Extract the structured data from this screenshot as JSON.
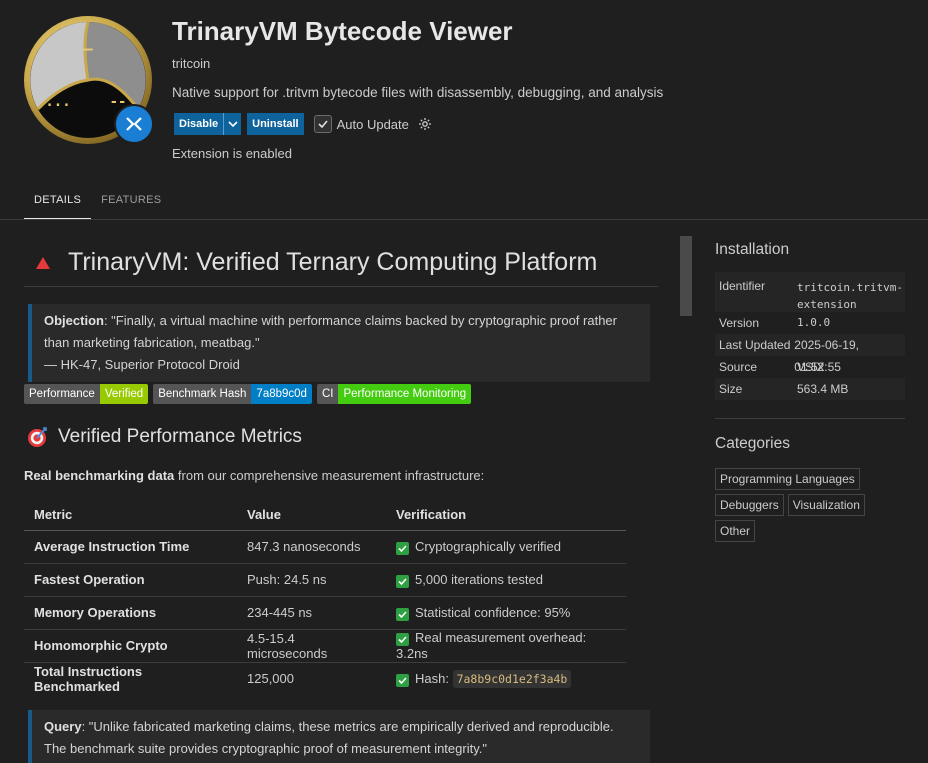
{
  "extension": {
    "title": "TrinaryVM Bytecode Viewer",
    "publisher": "tritcoin",
    "description": "Native support for .tritvm bytecode files with disassembly, debugging, and analysis",
    "logo_glyphs": {
      "top": "—",
      "bottom_left": "...",
      "bottom_right": "--"
    },
    "status": "Extension is enabled"
  },
  "actions": {
    "disable_label": "Disable",
    "uninstall_label": "Uninstall",
    "auto_update_label": "Auto Update",
    "auto_update_checked": true
  },
  "tabs": [
    {
      "label": "DETAILS",
      "active": true
    },
    {
      "label": "FEATURES",
      "active": false
    }
  ],
  "readme": {
    "h1_icon": "red-triangle-icon",
    "h1": "TrinaryVM: Verified Ternary Computing Platform",
    "objection": {
      "label": "Objection",
      "text": ": \"Finally, a virtual machine with performance claims backed by cryptographic proof rather than marketing fabrication, meatbag.\"",
      "attribution": "— HK-47, Superior Protocol Droid"
    },
    "badges": [
      {
        "key": "Performance",
        "value": "Verified",
        "color": "#97ca00"
      },
      {
        "key": "Benchmark Hash",
        "value": "7a8b9c0d",
        "color": "#007ec6"
      },
      {
        "key": "CI",
        "value": "Performance Monitoring",
        "color": "#4c1"
      }
    ],
    "h2_icon": "target-icon",
    "h2": "Verified Performance Metrics",
    "intro_bold": "Real benchmarking data",
    "intro_rest": " from our comprehensive measurement infrastructure:",
    "table": {
      "headers": [
        "Metric",
        "Value",
        "Verification"
      ],
      "rows": [
        {
          "metric": "Average Instruction Time",
          "value": "847.3 nanoseconds",
          "verification": "Cryptographically verified",
          "code": ""
        },
        {
          "metric": "Fastest Operation",
          "value": "Push: 24.5 ns",
          "verification": "5,000 iterations tested",
          "code": ""
        },
        {
          "metric": "Memory Operations",
          "value": "234-445 ns",
          "verification": "Statistical confidence: 95%",
          "code": ""
        },
        {
          "metric": "Homomorphic Crypto",
          "value": "4.5-15.4 microseconds",
          "verification": "Real measurement overhead: 3.2ns",
          "code": ""
        },
        {
          "metric": "Total Instructions Benchmarked",
          "value": "125,000",
          "verification": "Hash: ",
          "code": "7a8b9c0d1e2f3a4b"
        }
      ]
    },
    "query": {
      "label": "Query",
      "text": ": \"Unlike fabricated marketing claims, these metrics are empirically derived and reproducible. The benchmark suite provides cryptographic proof of measurement integrity.\""
    }
  },
  "installation": {
    "heading": "Installation",
    "rows": [
      {
        "label": "Identifier",
        "value": "tritcoin.tritvm-extension",
        "mono": true
      },
      {
        "label": "Version",
        "value": "1.0.0",
        "mono": true
      },
      {
        "label": "Last Updated",
        "value": "2025-06-19, 01:52:55",
        "mono": false
      },
      {
        "label": "Source",
        "value": "VSIX",
        "mono": false
      },
      {
        "label": "Size",
        "value": "563.4 MB",
        "mono": false
      }
    ]
  },
  "categories": {
    "heading": "Categories",
    "items": [
      "Programming Languages",
      "Debuggers",
      "Visualization",
      "Other"
    ]
  },
  "colors": {
    "accent_button": "#0e639c",
    "quote_border": "#195a8a",
    "check_green": "#2ea043",
    "logo_gold": "#c9a84a"
  }
}
